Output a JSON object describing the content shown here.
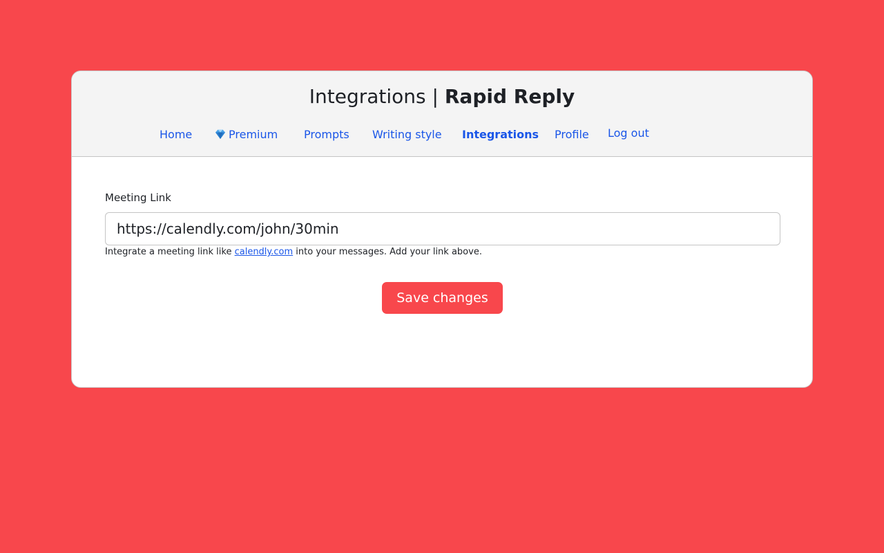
{
  "header": {
    "title_page": "Integrations",
    "title_separator": " | ",
    "title_brand": "Rapid Reply"
  },
  "nav": {
    "home": "Home",
    "premium": "Premium",
    "premium_icon": "gem-icon",
    "prompts": "Prompts",
    "writing_style": "Writing style",
    "integrations": "Integrations",
    "profile": "Profile",
    "logout": "Log out",
    "active": "Integrations"
  },
  "form": {
    "label": "Meeting Link",
    "value": "https://calendly.com/john/30min",
    "help_prefix": "Integrate a meeting link like ",
    "help_link": "calendly.com",
    "help_suffix": " into your messages. Add your link above.",
    "save_label": "Save changes"
  },
  "colors": {
    "background": "#f8474c",
    "accent": "#f8474c",
    "link": "#1a56e8"
  }
}
